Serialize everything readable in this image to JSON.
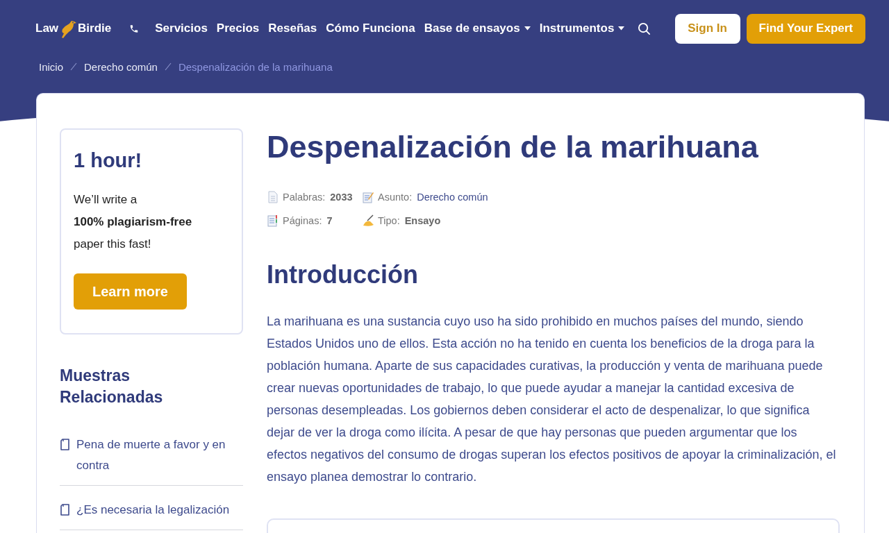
{
  "header": {
    "logo": {
      "left": "Law",
      "right": "Birdie"
    },
    "nav": [
      {
        "label": "Servicios",
        "dropdown": false
      },
      {
        "label": "Precios",
        "dropdown": false
      },
      {
        "label": "Reseñas",
        "dropdown": false
      },
      {
        "label": "Cómo Funciona",
        "dropdown": false
      },
      {
        "label": "Base de ensayos",
        "dropdown": true
      },
      {
        "label": "Instrumentos",
        "dropdown": true
      }
    ],
    "sign_in": "Sign In",
    "cta": "Find Your Expert"
  },
  "breadcrumb": [
    {
      "label": "Inicio",
      "current": false
    },
    {
      "label": "Derecho común",
      "current": false
    },
    {
      "label": "Despenalización de la marihuana",
      "current": true
    }
  ],
  "promo": {
    "title": "1 hour!",
    "text": "We’ll write a **100% plagiarism-free** paper this fast!",
    "button": "Learn more"
  },
  "related": {
    "title": "Muestras Relacionadas",
    "items": [
      "Pena de muerte a favor y en contra",
      "¿Es necesaria la legalización"
    ]
  },
  "article": {
    "title": "Despenalización de la marihuana",
    "meta": [
      {
        "label": "Palabras:",
        "value": "2033",
        "kind": "bold"
      },
      {
        "label": "Asunto:",
        "value": "Derecho común",
        "kind": "link"
      },
      {
        "label": "Páginas:",
        "value": "7",
        "kind": "bold"
      },
      {
        "label": "Tipo:",
        "value": "Ensayo",
        "kind": "bold"
      }
    ],
    "heading": "Introducción",
    "paragraph": "La marihuana es una sustancia cuyo uso ha sido prohibido en muchos países del mundo, siendo Estados Unidos uno de ellos. Esta acción no ha tenido en cuenta los beneficios de la droga para la población humana. Aparte de sus capacidades curativas, la producción y venta de marihuana puede crear nuevas oportunidades de trabajo, lo que puede ayudar a manejar la cantidad excesiva de personas desempleadas. Los gobiernos deben considerar el acto de despenalizar, lo que significa dejar de ver la droga como ilícita. A pesar de que hay personas que pueden argumentar que los efectos negativos del consumo de drogas superan los efectos positivos de apoyar la criminalización, el ensayo planea demostrar lo contrario."
  }
}
